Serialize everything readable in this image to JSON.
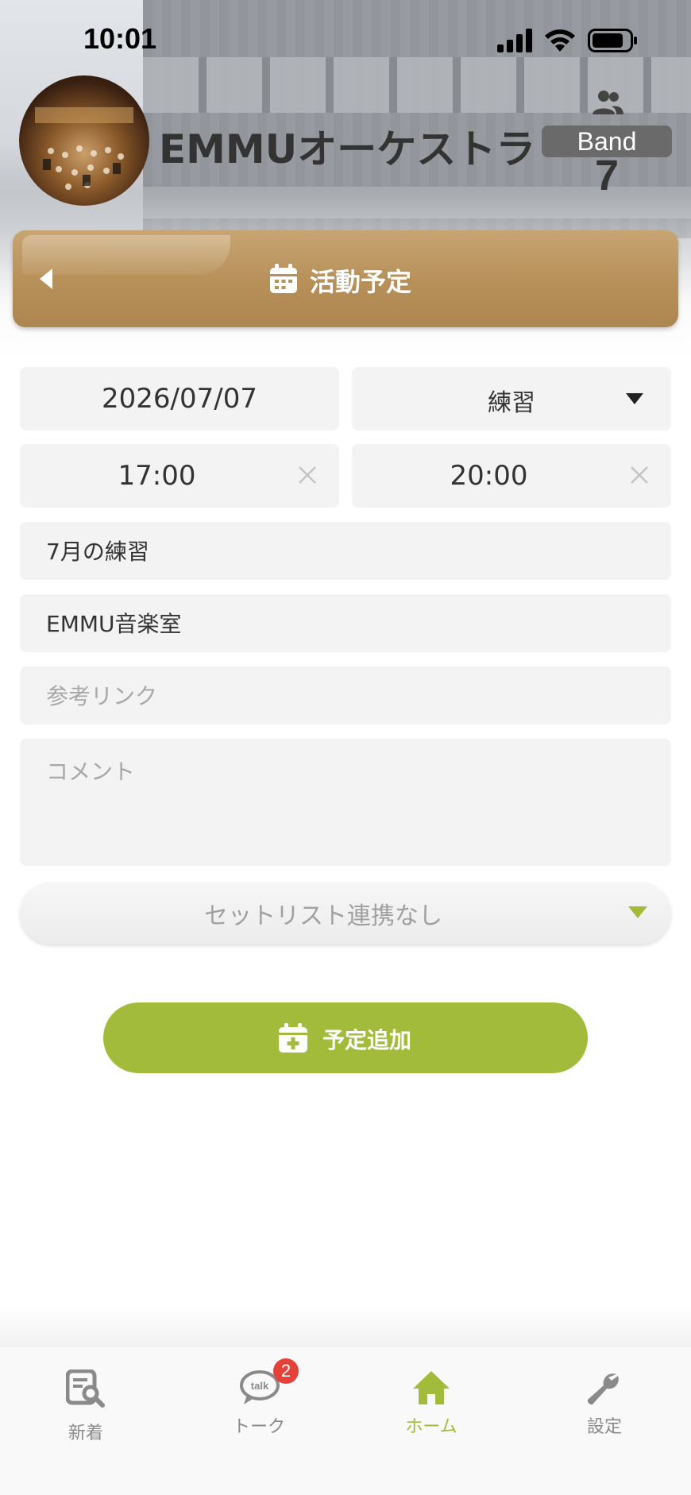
{
  "status_bar": {
    "time": "10:01"
  },
  "band": {
    "name": "EMMUオーケストラ",
    "tag": "Band",
    "member_count": "7"
  },
  "page": {
    "title": "活動予定"
  },
  "form": {
    "date": "2026/07/07",
    "type": "練習",
    "start_time": "17:00",
    "end_time": "20:00",
    "event_title": "7月の練習",
    "place": "EMMU音楽室",
    "link_placeholder": "参考リンク",
    "comment_placeholder": "コメント",
    "setlist": "セットリスト連携なし"
  },
  "actions": {
    "add_label": "予定追加"
  },
  "colors": {
    "accent": "#a3bb3a",
    "title_bar": "#b8915a",
    "badge": "#e5413a"
  },
  "bottom_nav": {
    "items": [
      {
        "label": "新着",
        "icon": "news-search-icon"
      },
      {
        "label": "トーク",
        "icon": "talk-bubble-icon",
        "badge": "2"
      },
      {
        "label": "ホーム",
        "icon": "home-icon",
        "active": true
      },
      {
        "label": "設定",
        "icon": "wrench-icon"
      }
    ]
  }
}
